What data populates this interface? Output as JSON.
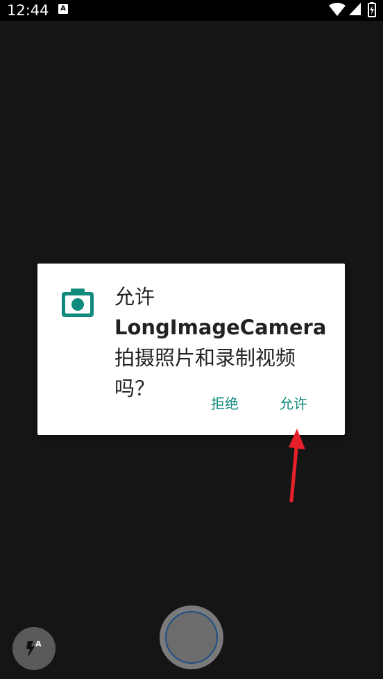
{
  "status_bar": {
    "time": "12:44",
    "notification_icon": "a-icon",
    "icons": [
      "wifi-icon",
      "signal-icon",
      "battery-icon"
    ]
  },
  "dialog": {
    "icon": "camera-icon",
    "message_prefix": "允许",
    "app_name": "LongImageCamera",
    "message_suffix": "拍摄照片和录制视频吗？",
    "deny_label": "拒绝",
    "allow_label": "允许",
    "accent_color": "#118a7e"
  },
  "annotation": {
    "arrow_color": "#e8202a"
  },
  "controls": {
    "flash_icon": "flash-auto-icon",
    "flash_badge": "A",
    "shutter": "shutter-button"
  }
}
